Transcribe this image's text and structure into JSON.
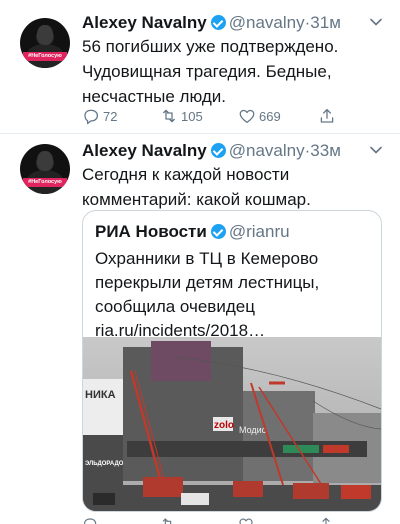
{
  "tweets": [
    {
      "author": "Alexey Navalny",
      "handle": "@navalny",
      "separator": "·",
      "time": "31м",
      "text": "56 погибших уже подтверждено. Чудовищная трагедия. Бедные, несчастные люди.",
      "avatar_tag": "#НеГолосую",
      "replies": "72",
      "retweets": "105",
      "likes": "669"
    },
    {
      "author": "Alexey Navalny",
      "handle": "@navalny",
      "separator": "·",
      "time": "33м",
      "text": "Сегодня к каждой новости комментарий: какой кошмар.",
      "avatar_tag": "#НеГолосую",
      "quote": {
        "author": "РИА Новости",
        "handle": "@rianru",
        "text": "Охранники в ТЦ в Кемерово перекрыли детям лестницы, сообщила очевидец ria.ru/incidents/2018…",
        "photo_signs": {
          "left": "НИКА",
          "left_bottom": "ЭЛЬДОРАДО",
          "center": "zolo",
          "right": "Модис"
        }
      }
    }
  ],
  "colors": {
    "accent": "#1da1f2",
    "muted": "#657786",
    "text": "#14171a",
    "divider": "#e6ecf0",
    "avatar_tag": "#e0245e"
  },
  "icons": {
    "reply": "reply-icon",
    "retweet": "retweet-icon",
    "like": "heart-icon",
    "share": "share-icon",
    "menu": "chevron-down-icon",
    "verified": "verified-badge-icon"
  }
}
